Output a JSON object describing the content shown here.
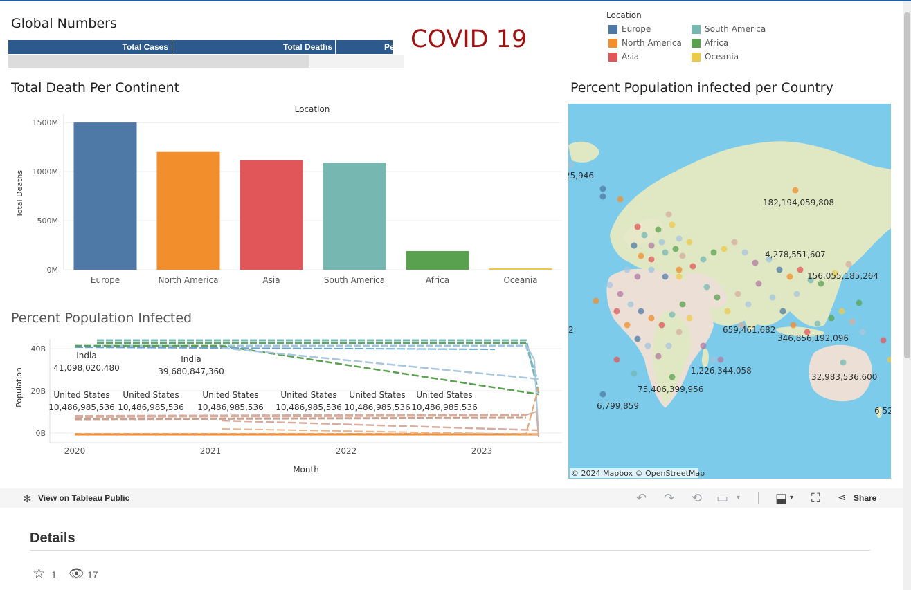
{
  "dashboard": {
    "covid_title": "COVID 19",
    "global_numbers": {
      "title": "Global Numbers",
      "headers": [
        "Total Cases",
        "Total Deaths",
        "Pe"
      ]
    },
    "legend": {
      "title": "Location",
      "items": [
        {
          "label": "Europe",
          "color": "#4e79a7"
        },
        {
          "label": "South America",
          "color": "#76b7b2"
        },
        {
          "label": "North America",
          "color": "#f28e2b"
        },
        {
          "label": "Africa",
          "color": "#59a14f"
        },
        {
          "label": "Asia",
          "color": "#e15759"
        },
        {
          "label": "Oceania",
          "color": "#edc948"
        }
      ]
    },
    "bar_title": "Total Death Per  Continent",
    "line_title": "Percent Population Infected",
    "map": {
      "title": "Percent Population infected per Country",
      "attribution": "© 2024 Mapbox  © OpenStreetMap",
      "labels": [
        "25,946",
        "182,194,059,808",
        "4,278,551,607",
        "156,055,185,264",
        "2",
        "659,461,682",
        "346,856,192,096",
        "1,226,344,058",
        "75,406,399,956",
        "32,983,536,600",
        "6,799,859",
        "6,52"
      ]
    }
  },
  "chart_data": [
    {
      "type": "bar",
      "title": "Location",
      "ylabel": "Total Deaths",
      "xlabel": "",
      "categories": [
        "Europe",
        "North America",
        "Asia",
        "South America",
        "Africa",
        "Oceania"
      ],
      "values": [
        1500,
        1200,
        1115,
        1090,
        190,
        8
      ],
      "value_unit": "M",
      "colors": [
        "#4e79a7",
        "#f28e2b",
        "#e15759",
        "#76b7b2",
        "#59a14f",
        "#edc948"
      ],
      "yticks": [
        "1500M",
        "1000M",
        "500M",
        "0M"
      ],
      "ylim": [
        0,
        1550
      ]
    },
    {
      "type": "line",
      "title": "",
      "xlabel": "Month",
      "ylabel": "Population",
      "xticks": [
        "2020",
        "2021",
        "2022",
        "2023"
      ],
      "yticks": [
        "40B",
        "20B",
        "0B"
      ],
      "ylim": [
        0,
        48
      ],
      "annotations": [
        {
          "country": "India",
          "value": "41,098,020,480"
        },
        {
          "country": "India",
          "value": "39,680,847,360"
        },
        {
          "country": "United States",
          "value": "10,486,985,536"
        },
        {
          "country": "United States",
          "value": "10,486,985,536"
        },
        {
          "country": "United States",
          "value": "10,486,985,536"
        },
        {
          "country": "United States",
          "value": "10,486,985,536"
        },
        {
          "country": "United States",
          "value": "10,486,985,536"
        },
        {
          "country": "United States",
          "value": "10,486,985,536"
        }
      ]
    }
  ],
  "toolbar": {
    "view_label": "View on Tableau Public",
    "share_label": "Share"
  },
  "details": {
    "heading": "Details",
    "favorites": "1",
    "views": "17"
  }
}
